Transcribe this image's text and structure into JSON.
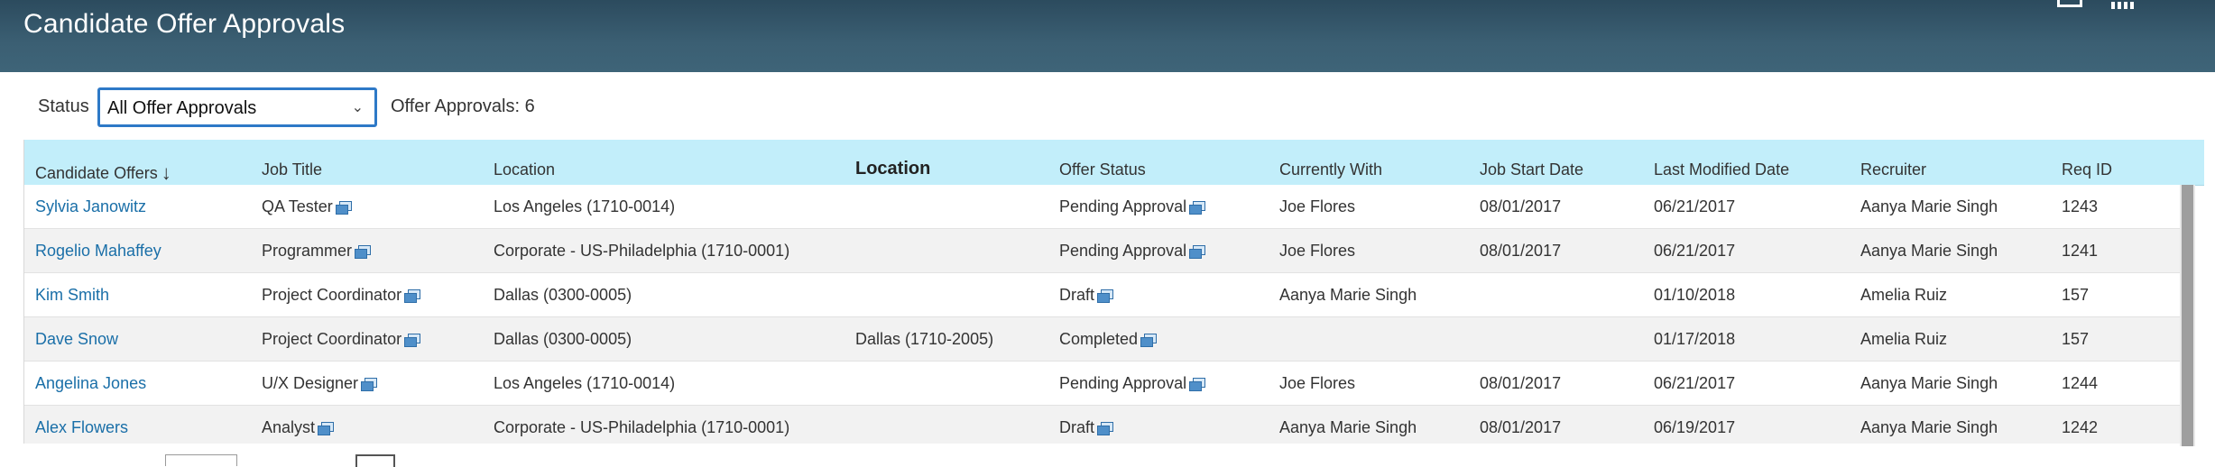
{
  "header": {
    "title": "Candidate Offer Approvals",
    "icons": [
      "window-icon",
      "bar-chart-icon"
    ]
  },
  "filter": {
    "status_label": "Status",
    "status_value": "All Offer Approvals",
    "count_label": "Offer Approvals: 6"
  },
  "table": {
    "columns": [
      "Candidate Offers",
      "Job Title",
      "Location",
      "Location",
      "Offer Status",
      "Currently With",
      "Job Start Date",
      "Last Modified Date",
      "Recruiter",
      "Req ID"
    ],
    "sort_indicator": "↓",
    "rows": [
      [
        "Sylvia Janowitz",
        "QA Tester",
        "Los Angeles (1710-0014)",
        "",
        "Pending Approval",
        "Joe Flores",
        "08/01/2017",
        "06/21/2017",
        "Aanya Marie Singh",
        "1243"
      ],
      [
        "Rogelio Mahaffey",
        "Programmer",
        "Corporate - US-Philadelphia (1710-0001)",
        "",
        "Pending Approval",
        "Joe Flores",
        "08/01/2017",
        "06/21/2017",
        "Aanya Marie Singh",
        "1241"
      ],
      [
        "Kim Smith",
        "Project Coordinator",
        "Dallas (0300-0005)",
        "",
        "Draft",
        "Aanya Marie Singh",
        "",
        "01/10/2018",
        "Amelia Ruiz",
        "157"
      ],
      [
        "Dave Snow",
        "Project Coordinator",
        "Dallas (0300-0005)",
        "Dallas (1710-2005)",
        "Completed",
        "",
        "",
        "01/17/2018",
        "Amelia Ruiz",
        "157"
      ],
      [
        "Angelina Jones",
        "U/X Designer",
        "Los Angeles (1710-0014)",
        "",
        "Pending Approval",
        "Joe Flores",
        "08/01/2017",
        "06/21/2017",
        "Aanya Marie Singh",
        "1244"
      ],
      [
        "Alex Flowers",
        "Analyst",
        "Corporate - US-Philadelphia (1710-0001)",
        "",
        "Draft",
        "Aanya Marie Singh",
        "08/01/2017",
        "06/19/2017",
        "Aanya Marie Singh",
        "1242"
      ]
    ]
  },
  "colors": {
    "header_bg": "#34566a",
    "table_header_bg": "#c2eefa",
    "link": "#1a6fa8",
    "select_border": "#2e79c7"
  }
}
